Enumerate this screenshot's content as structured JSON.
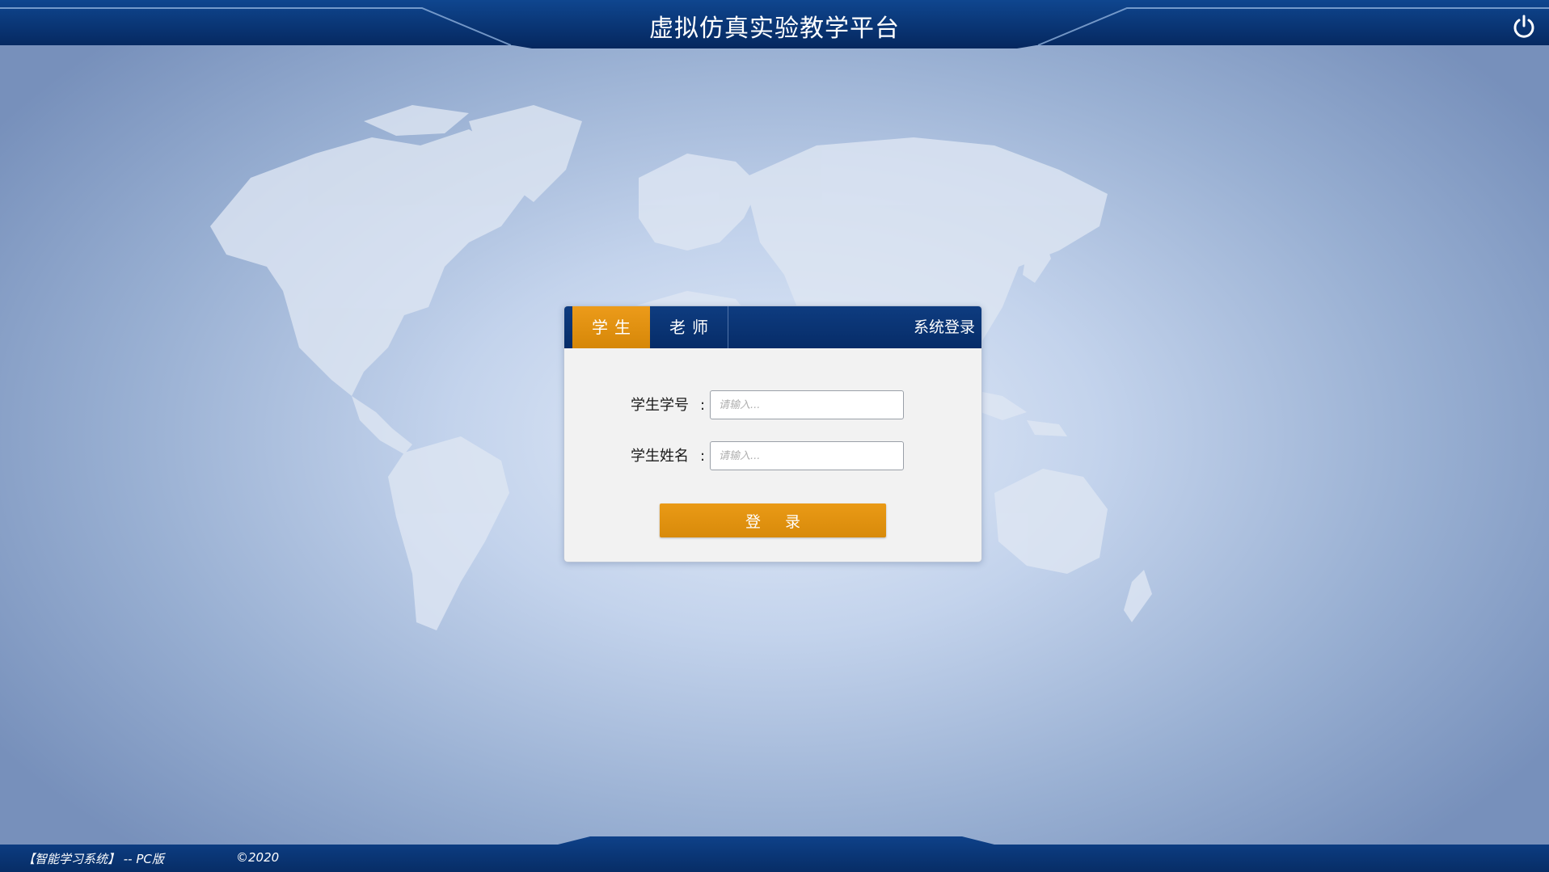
{
  "header": {
    "title": "虚拟仿真实验教学平台",
    "power_icon": "power-icon"
  },
  "login": {
    "tabs": [
      {
        "label": "学生",
        "active": true
      },
      {
        "label": "老师",
        "active": false
      }
    ],
    "panel_title": "系统登录",
    "fields": [
      {
        "label": "学生学号",
        "colon": ":",
        "placeholder": "请输入...",
        "value": ""
      },
      {
        "label": "学生姓名",
        "colon": ":",
        "placeholder": "请输入...",
        "value": ""
      }
    ],
    "submit_label": "登录"
  },
  "footer": {
    "system_name": "【智能学习系统】 -- PC版",
    "copyright": "©2020"
  },
  "colors": {
    "header_blue": "#0a3577",
    "accent_orange": "#e0900f",
    "background_light": "#e4ecf8",
    "background_dark": "#7790bb"
  }
}
